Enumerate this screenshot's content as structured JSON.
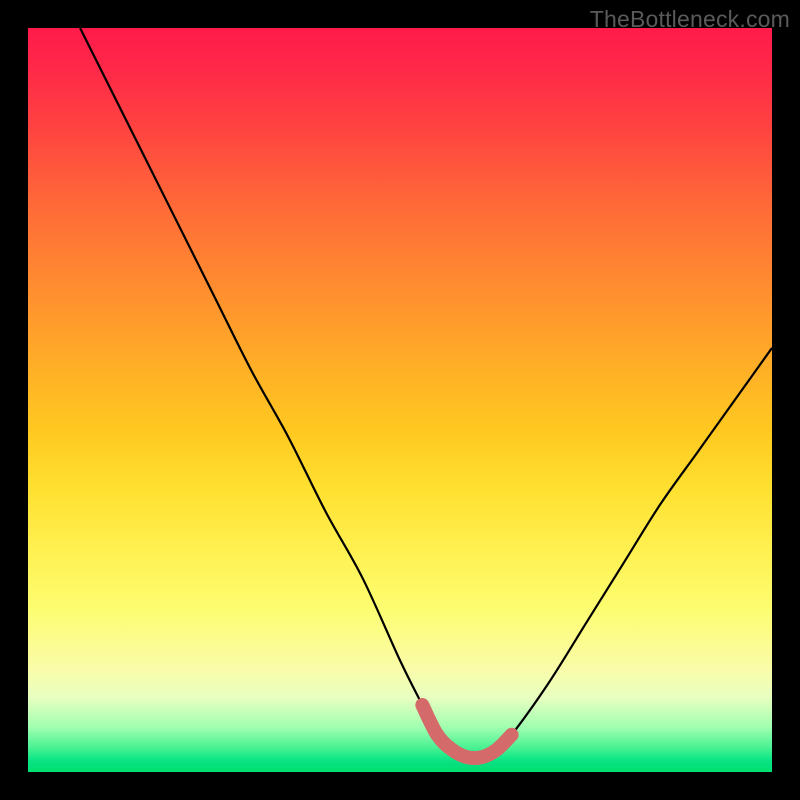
{
  "watermark": "TheBottleneck.com",
  "chart_data": {
    "type": "line",
    "title": "",
    "xlabel": "",
    "ylabel": "",
    "xlim": [
      0,
      100
    ],
    "ylim": [
      0,
      100
    ],
    "grid": false,
    "series": [
      {
        "name": "bottleneck-curve",
        "x": [
          7,
          10,
          15,
          20,
          25,
          30,
          35,
          40,
          45,
          50,
          53,
          55,
          57,
          59,
          61,
          63,
          65,
          70,
          75,
          80,
          85,
          90,
          95,
          100
        ],
        "values": [
          100,
          94,
          84,
          74,
          64,
          54,
          45,
          35,
          26,
          15,
          9,
          5,
          3,
          2,
          2,
          3,
          5,
          12,
          20,
          28,
          36,
          43,
          50,
          57
        ]
      },
      {
        "name": "highlight-region",
        "x": [
          53,
          55,
          57,
          59,
          61,
          63,
          65
        ],
        "values": [
          9,
          5,
          3,
          2,
          2,
          3,
          5
        ]
      }
    ],
    "colors": {
      "curve": "#000000",
      "highlight": "#d46a6a",
      "background_top": "#ff1a4a",
      "background_mid": "#ffe030",
      "background_bottom": "#00e070"
    }
  }
}
